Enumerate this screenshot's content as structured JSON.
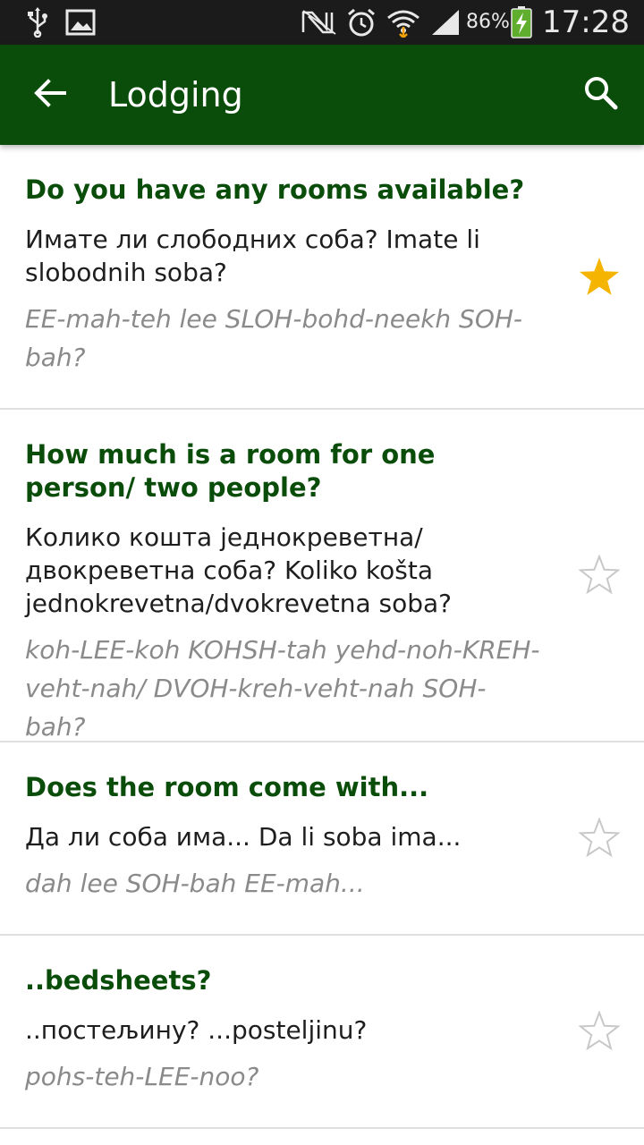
{
  "status_bar": {
    "battery_percent": "86%",
    "time": "17:28",
    "icons": [
      "usb-icon",
      "image-icon",
      "nfc-icon",
      "alarm-icon",
      "wifi-icon",
      "signal-icon",
      "battery-charging-icon"
    ]
  },
  "app_bar": {
    "title": "Lodging",
    "back_icon": "arrow-back-icon",
    "search_icon": "search-icon",
    "background_color": "#0a4d0a"
  },
  "phrases": [
    {
      "english": "Do you have any rooms available?",
      "translation": "Имате ли слободних соба? Imate li slobodnih soba?",
      "pronunciation": "EE-mah-teh lee SLOH-bohd-neekh SOH-bah?",
      "favorite": true
    },
    {
      "english": "How much is a room for one person/ two people?",
      "translation": "Колико кошта једнокреветна/ двокреветна соба? Koliko košta jednokrevetna/dvokrevetna soba?",
      "pronunciation": "koh-LEE-koh KOHSH-tah yehd-noh-KREH-veht-nah/ DVOH-kreh-veht-nah SOH-bah?",
      "favorite": false
    },
    {
      "english": "Does the room come with...",
      "translation": "Да ли соба има... Da li soba ima...",
      "pronunciation": "dah lee SOH-bah EE-mah...",
      "favorite": false
    },
    {
      "english": "..bedsheets?",
      "translation": "..постељину? ...posteljinu?",
      "pronunciation": "pohs-teh-LEE-noo?",
      "favorite": false
    }
  ],
  "colors": {
    "accent_green": "#0a4d0a",
    "star_filled": "#f5b400",
    "star_outline": "#c8c8c8"
  }
}
